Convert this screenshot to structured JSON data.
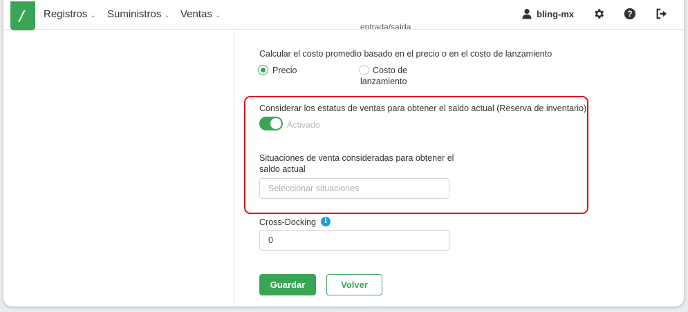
{
  "nav": {
    "items": [
      {
        "label": "Registros"
      },
      {
        "label": "Suministros"
      },
      {
        "label": "Ventas"
      }
    ],
    "user": "bling-mx"
  },
  "form": {
    "cut_off_text": "entrada/saída",
    "cost_section": {
      "label": "Calcular el costo promedio basado en el precio o en el costo de lanzamiento",
      "options": [
        {
          "label": "Precio",
          "selected": true
        },
        {
          "label_line1": "Costo de",
          "label_line2": "lanzamiento",
          "selected": false
        }
      ]
    },
    "sales_status": {
      "label": "Considerar los estatus de ventas para obtener el saldo actual (Reserva de inventario)",
      "toggle_label": "Activado",
      "enabled": true
    },
    "situations": {
      "label_line1": "Situaciones de venta consideradas para obtener el",
      "label_line2": "saldo actual",
      "placeholder": "Seleccionar situaciones"
    },
    "cross_docking": {
      "label": "Cross-Docking",
      "value": "0",
      "info_icon": "info-icon"
    },
    "buttons": {
      "save": "Guardar",
      "back": "Volver"
    }
  },
  "colors": {
    "brand_green": "#3aa655",
    "highlight_red": "#e0101e",
    "info_blue": "#1aa0e0"
  }
}
